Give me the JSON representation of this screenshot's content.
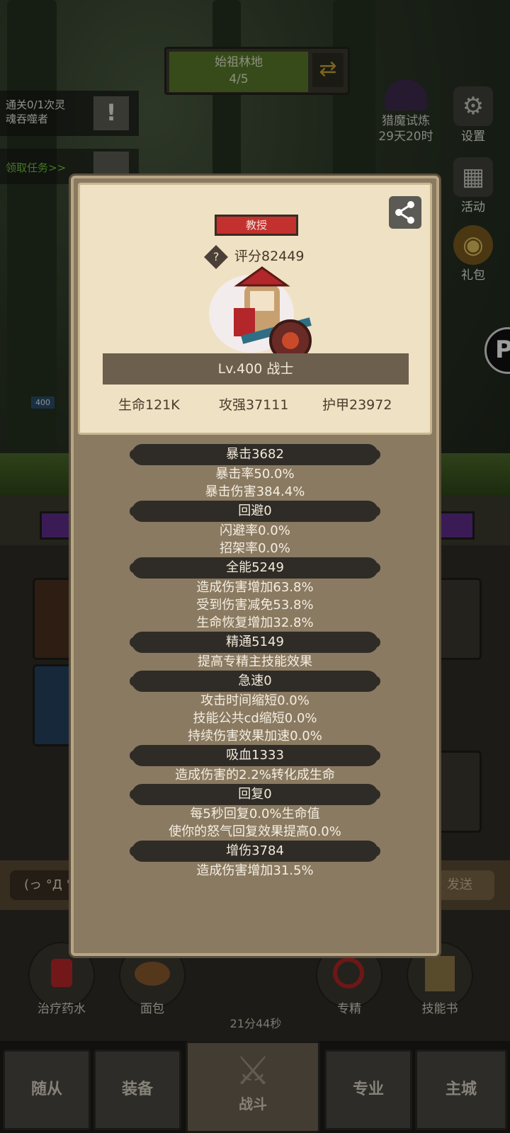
{
  "stage": {
    "name": "始祖林地",
    "progress": "4/5",
    "swap_icon": "swap-arrows-icon"
  },
  "quest": {
    "line1": "通关0/1次灵",
    "line2": "魂吞噬者",
    "claim": "领取任务>>"
  },
  "hunt": {
    "label": "猎魔试炼",
    "time": "29天20时"
  },
  "side_menu": [
    {
      "label": "设置",
      "icon": "gear-icon"
    },
    {
      "label": "活动",
      "icon": "calendar-icon"
    },
    {
      "label": "礼包",
      "icon": "gift-icon"
    }
  ],
  "hero_level_chip": "400",
  "chat": {
    "input_text": "(っ °Д °;",
    "send_label": "发送"
  },
  "quick_items": [
    {
      "label": "治疗药水",
      "icon": "potion-icon"
    },
    {
      "label": "面包",
      "icon": "bread-icon"
    },
    {
      "label": "21分44秒",
      "icon": "chest-icon"
    },
    {
      "label": "专精",
      "icon": "spec-icon"
    },
    {
      "label": "技能书",
      "icon": "book-icon"
    }
  ],
  "bottom_tabs": [
    "随从",
    "装备",
    "战斗",
    "专业",
    "主城"
  ],
  "popup": {
    "title_badge": "教授",
    "score": "评分82449",
    "level": "Lv.400 战士",
    "hp": "生命121K",
    "attack": "攻强37111",
    "armor": "护甲23972",
    "attributes": [
      {
        "name": "暴击3682",
        "details": [
          "暴击率50.0%",
          "暴击伤害384.4%"
        ]
      },
      {
        "name": "回避0",
        "details": [
          "闪避率0.0%",
          "招架率0.0%"
        ]
      },
      {
        "name": "全能5249",
        "details": [
          "造成伤害增加63.8%",
          "受到伤害减免53.8%",
          "生命恢复增加32.8%"
        ]
      },
      {
        "name": "精通5149",
        "details": [
          "提高专精主技能效果"
        ]
      },
      {
        "name": "急速0",
        "details": [
          "攻击时间缩短0.0%",
          "技能公共cd缩短0.0%",
          "持续伤害效果加速0.0%"
        ]
      },
      {
        "name": "吸血1333",
        "details": [
          "造成伤害的2.2%转化成生命"
        ]
      },
      {
        "name": "回复0",
        "details": [
          "每5秒回复0.0%生命值",
          "使你的怒气回复效果提高0.0%"
        ]
      },
      {
        "name": "增伤3784",
        "details": [
          "造成伤害增加31.5%"
        ]
      }
    ]
  },
  "colors": {
    "badge_red": "#c3312f",
    "parchment": "#efe1c3",
    "panel": "#8a7a62"
  }
}
